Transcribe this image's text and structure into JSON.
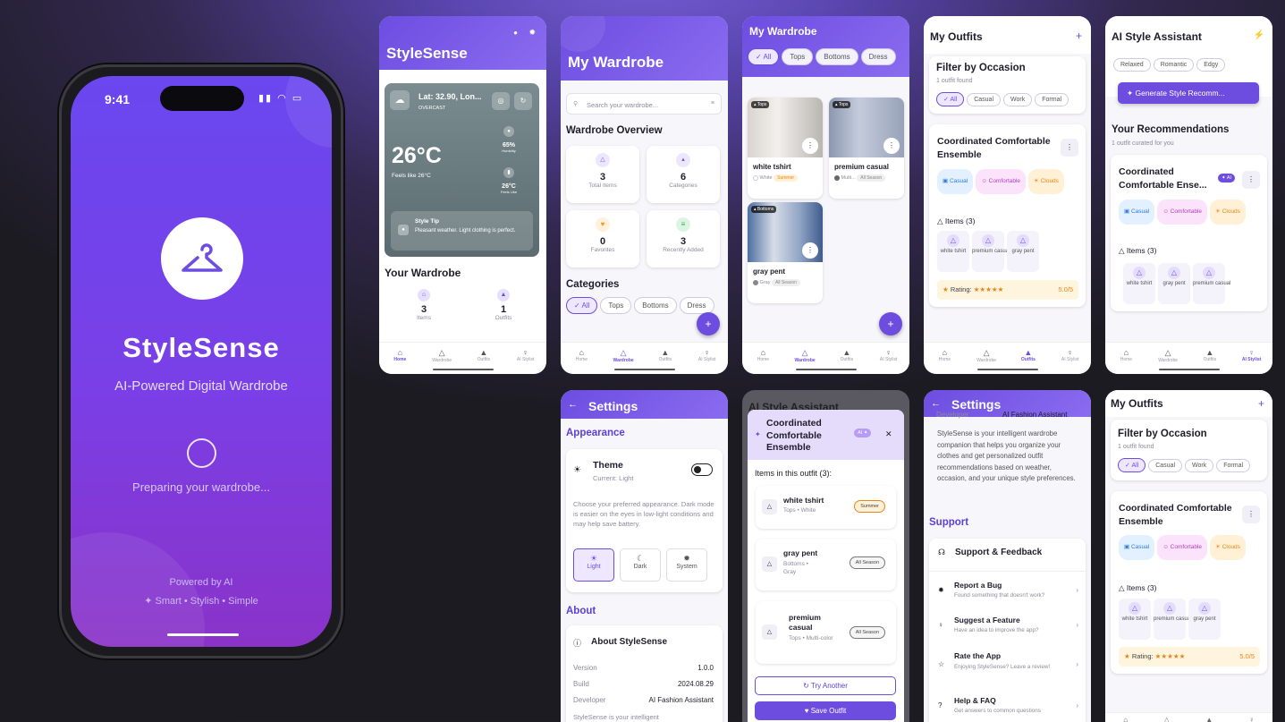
{
  "splash": {
    "time": "9:41",
    "app_name": "StyleSense",
    "tagline": "AI-Powered Digital Wardrobe",
    "loading": "Preparing your wardrobe...",
    "powered": "Powered by AI",
    "slogan": "Smart • Stylish • Simple"
  },
  "nav": {
    "home": "Home",
    "wardrobe": "Wardrobe",
    "outfits": "Outfits",
    "stylist": "AI Stylist"
  },
  "home": {
    "title": "StyleSense",
    "location": "Lat: 32.90, Lon...",
    "condition": "OVERCAST",
    "temp": "26°C",
    "feels": "Feels like 26°C",
    "humidity": "65%",
    "humidity_label": "Humidity",
    "feels_val": "26°C",
    "feels_label": "Feels Like",
    "tip_title": "Style Tip",
    "tip_text": "Pleasant weather. Light clothing is perfect.",
    "section": "Your Wardrobe",
    "items_count": "3",
    "items_label": "Items",
    "outfits_count": "1",
    "outfits_label": "Outfits"
  },
  "wardrobe": {
    "title": "My Wardrobe",
    "search_placeholder": "Search your wardrobe...",
    "overview": "Wardrobe Overview",
    "stats": [
      {
        "v": "3",
        "l": "Total Items"
      },
      {
        "v": "6",
        "l": "Categories"
      },
      {
        "v": "0",
        "l": "Favorites"
      },
      {
        "v": "3",
        "l": "Recently Added"
      }
    ],
    "categories_title": "Categories",
    "chips": [
      "All",
      "Tops",
      "Bottoms",
      "Dress"
    ]
  },
  "grid": {
    "title": "My Wardrobe",
    "chips": [
      "All",
      "Tops",
      "Bottoms",
      "Dress"
    ],
    "items": [
      {
        "badge": "Tops",
        "name": "white tshirt",
        "color": "White",
        "season": "Summer"
      },
      {
        "badge": "Tops",
        "name": "premium casual",
        "color": "Multi...",
        "season": "All Season"
      },
      {
        "badge": "Bottoms",
        "name": "gray pent",
        "color": "Gray",
        "season": "All Season"
      }
    ]
  },
  "outfits": {
    "title": "My Outfits",
    "filter": "Filter by Occasion",
    "found": "1 outfit found",
    "chips": [
      "All",
      "Casual",
      "Work",
      "Formal"
    ],
    "outfit_name": "Coordinated Comfortable Ensemble",
    "tags": [
      "Casual",
      "Comfortable",
      "Clouds"
    ],
    "items_title": "Items (3)",
    "items": [
      "white tshirt",
      "premium casual",
      "gray pent"
    ],
    "rating_label": "Rating:",
    "stars": "★★★★★",
    "rating": "5.0/5"
  },
  "assistant": {
    "title": "AI Style Assistant",
    "chips": [
      "Relaxed",
      "Romantic",
      "Edgy"
    ],
    "generate": "Generate Style Recomm...",
    "recs_title": "Your Recommendations",
    "recs_sub": "1 outfit curated for you",
    "outfit_name": "Coordinated Comfortable Ense...",
    "ai_badge": "AI",
    "tags": [
      "Casual",
      "Comfortable",
      "Clouds"
    ],
    "items_title": "Items (3)",
    "items": [
      "white tshirt",
      "gray pent",
      "premium casual"
    ]
  },
  "settings": {
    "title": "Settings",
    "appearance": "Appearance",
    "theme": "Theme",
    "theme_current": "Current: Light",
    "theme_desc": "Choose your preferred appearance. Dark mode is easier on the eyes in low-light conditions and may help save battery.",
    "modes": [
      "Light",
      "Dark",
      "System"
    ],
    "about": "About",
    "about_app": "About StyleSense",
    "rows": [
      {
        "k": "Version",
        "v": "1.0.0"
      },
      {
        "k": "Build",
        "v": "2024.08.29"
      },
      {
        "k": "Developer",
        "v": "AI Fashion Assistant"
      }
    ],
    "cut": "StyleSense is your intelligent"
  },
  "modal": {
    "bg_title": "AI Style Assistant",
    "title": "Coordinated Comfortable Ensemble",
    "badge": "AI",
    "items_title": "Items in this outfit (3):",
    "items": [
      {
        "name": "white tshirt",
        "sub": "Tops • White",
        "season": "Summer"
      },
      {
        "name": "gray pent",
        "sub": "Bottoms • Gray",
        "season": "All Season"
      },
      {
        "name": "premium casual",
        "sub": "Tops • Multi-color",
        "season": "All Season"
      }
    ],
    "try": "Try Another",
    "save": "Save Outfit"
  },
  "settings2": {
    "title": "Settings",
    "dev_k": "Developer",
    "dev_v": "AI Fashion Assistant",
    "desc": "StyleSense is your intelligent wardrobe companion that helps you organize your clothes and get personalized outfit recommendations based on weather, occasion, and your unique style preferences.",
    "support": "Support",
    "feedback": "Support & Feedback",
    "rows": [
      {
        "t": "Report a Bug",
        "s": "Found something that doesn't work?"
      },
      {
        "t": "Suggest a Feature",
        "s": "Have an idea to improve the app?"
      },
      {
        "t": "Rate the App",
        "s": "Enjoying StyleSense? Leave a review!"
      },
      {
        "t": "Help & FAQ",
        "s": "Get answers to common questions"
      }
    ]
  },
  "colors": {
    "accent": "#6d4de0",
    "bg": "#2a2540"
  }
}
